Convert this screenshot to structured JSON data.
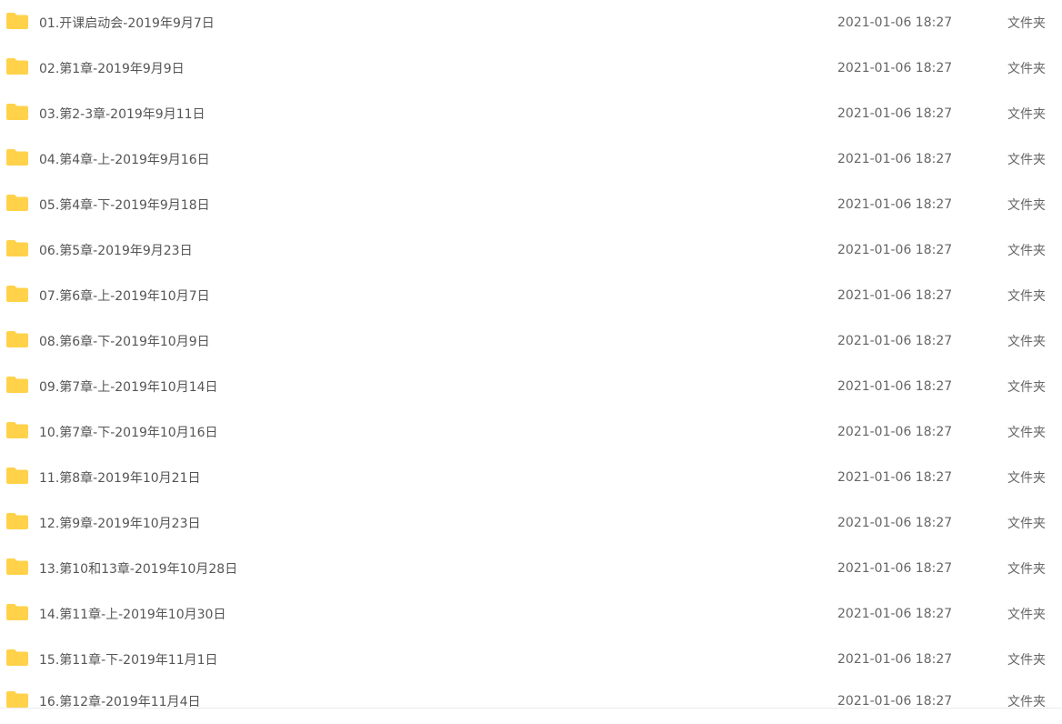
{
  "files": [
    {
      "name": "01.开课启动会-2019年9月7日",
      "date": "2021-01-06 18:27",
      "type": "文件夹",
      "icon": "folder-icon"
    },
    {
      "name": "02.第1章-2019年9月9日",
      "date": "2021-01-06 18:27",
      "type": "文件夹",
      "icon": "folder-icon"
    },
    {
      "name": "03.第2-3章-2019年9月11日",
      "date": "2021-01-06 18:27",
      "type": "文件夹",
      "icon": "folder-icon"
    },
    {
      "name": "04.第4章-上-2019年9月16日",
      "date": "2021-01-06 18:27",
      "type": "文件夹",
      "icon": "folder-icon"
    },
    {
      "name": "05.第4章-下-2019年9月18日",
      "date": "2021-01-06 18:27",
      "type": "文件夹",
      "icon": "folder-icon"
    },
    {
      "name": "06.第5章-2019年9月23日",
      "date": "2021-01-06 18:27",
      "type": "文件夹",
      "icon": "folder-icon"
    },
    {
      "name": "07.第6章-上-2019年10月7日",
      "date": "2021-01-06 18:27",
      "type": "文件夹",
      "icon": "folder-icon"
    },
    {
      "name": "08.第6章-下-2019年10月9日",
      "date": "2021-01-06 18:27",
      "type": "文件夹",
      "icon": "folder-icon"
    },
    {
      "name": "09.第7章-上-2019年10月14日",
      "date": "2021-01-06 18:27",
      "type": "文件夹",
      "icon": "folder-icon"
    },
    {
      "name": "10.第7章-下-2019年10月16日",
      "date": "2021-01-06 18:27",
      "type": "文件夹",
      "icon": "folder-icon"
    },
    {
      "name": "11.第8章-2019年10月21日",
      "date": "2021-01-06 18:27",
      "type": "文件夹",
      "icon": "folder-icon"
    },
    {
      "name": "12.第9章-2019年10月23日",
      "date": "2021-01-06 18:27",
      "type": "文件夹",
      "icon": "folder-icon"
    },
    {
      "name": "13.第10和13章-2019年10月28日",
      "date": "2021-01-06 18:27",
      "type": "文件夹",
      "icon": "folder-icon"
    },
    {
      "name": "14.第11章-上-2019年10月30日",
      "date": "2021-01-06 18:27",
      "type": "文件夹",
      "icon": "folder-icon"
    },
    {
      "name": "15.第11章-下-2019年11月1日",
      "date": "2021-01-06 18:27",
      "type": "文件夹",
      "icon": "folder-icon"
    },
    {
      "name": "16.第12章-2019年11月4日",
      "date": "2021-01-06 18:27",
      "type": "文件夹",
      "icon": "folder-icon"
    }
  ],
  "colors": {
    "folder_fill": "#ffd24a",
    "folder_tab": "#f6c23a"
  }
}
